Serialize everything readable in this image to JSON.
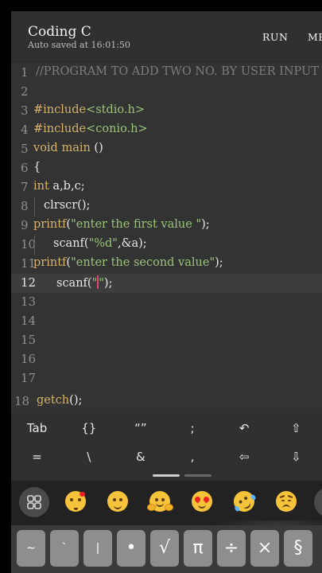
{
  "header": {
    "title": "Coding C",
    "subtitle": "Auto saved at 16:01:50",
    "run_label": "RUN",
    "menu_label": "MENU"
  },
  "editor": {
    "active_line": 12,
    "lines": [
      {
        "n": "1",
        "code": "//PROGRAM TO ADD TWO NO. BY USER INPUT"
      },
      {
        "n": "2",
        "code": ""
      },
      {
        "n": "3",
        "code": "#include<stdio.h>"
      },
      {
        "n": "4",
        "code": "#include<conio.h>"
      },
      {
        "n": "5",
        "code": "void main ()"
      },
      {
        "n": "6",
        "code": "{"
      },
      {
        "n": "7",
        "code": "int a,b,c;"
      },
      {
        "n": "8",
        "code": "clrscr();"
      },
      {
        "n": "9",
        "code": "printf(\"enter the first value \");"
      },
      {
        "n": "10",
        "code": "scanf(\"%d\",&a);"
      },
      {
        "n": "11",
        "code": "printf(\"enter the second value\");"
      },
      {
        "n": "12",
        "code": "scanf(\"\");"
      },
      {
        "n": "13",
        "code": ""
      },
      {
        "n": "14",
        "code": ""
      },
      {
        "n": "15",
        "code": ""
      },
      {
        "n": "16",
        "code": ""
      },
      {
        "n": "17",
        "code": ""
      },
      {
        "n": "18",
        "code": "getch();"
      }
    ]
  },
  "symbol_keys": {
    "row1": [
      "Tab",
      "{}",
      "“”",
      ";",
      "↶",
      "⇧"
    ],
    "row2": [
      "=",
      "\\",
      "&",
      ",",
      "⇦",
      "⇩"
    ]
  },
  "emoji_bar": {
    "grid_icon": "grid-icon",
    "emojis": [
      "kissing-heart",
      "grinning",
      "hugging",
      "heart-eyes",
      "rofl",
      "disappointed"
    ]
  },
  "bottom_keys": [
    "~",
    "`",
    "|",
    "•",
    "√",
    "π",
    "÷",
    "×",
    "§"
  ],
  "colors": {
    "keyword": "#d7b36a",
    "string": "#9bc47a",
    "comment": "#7d7d7d",
    "caret": "#e0457a"
  }
}
